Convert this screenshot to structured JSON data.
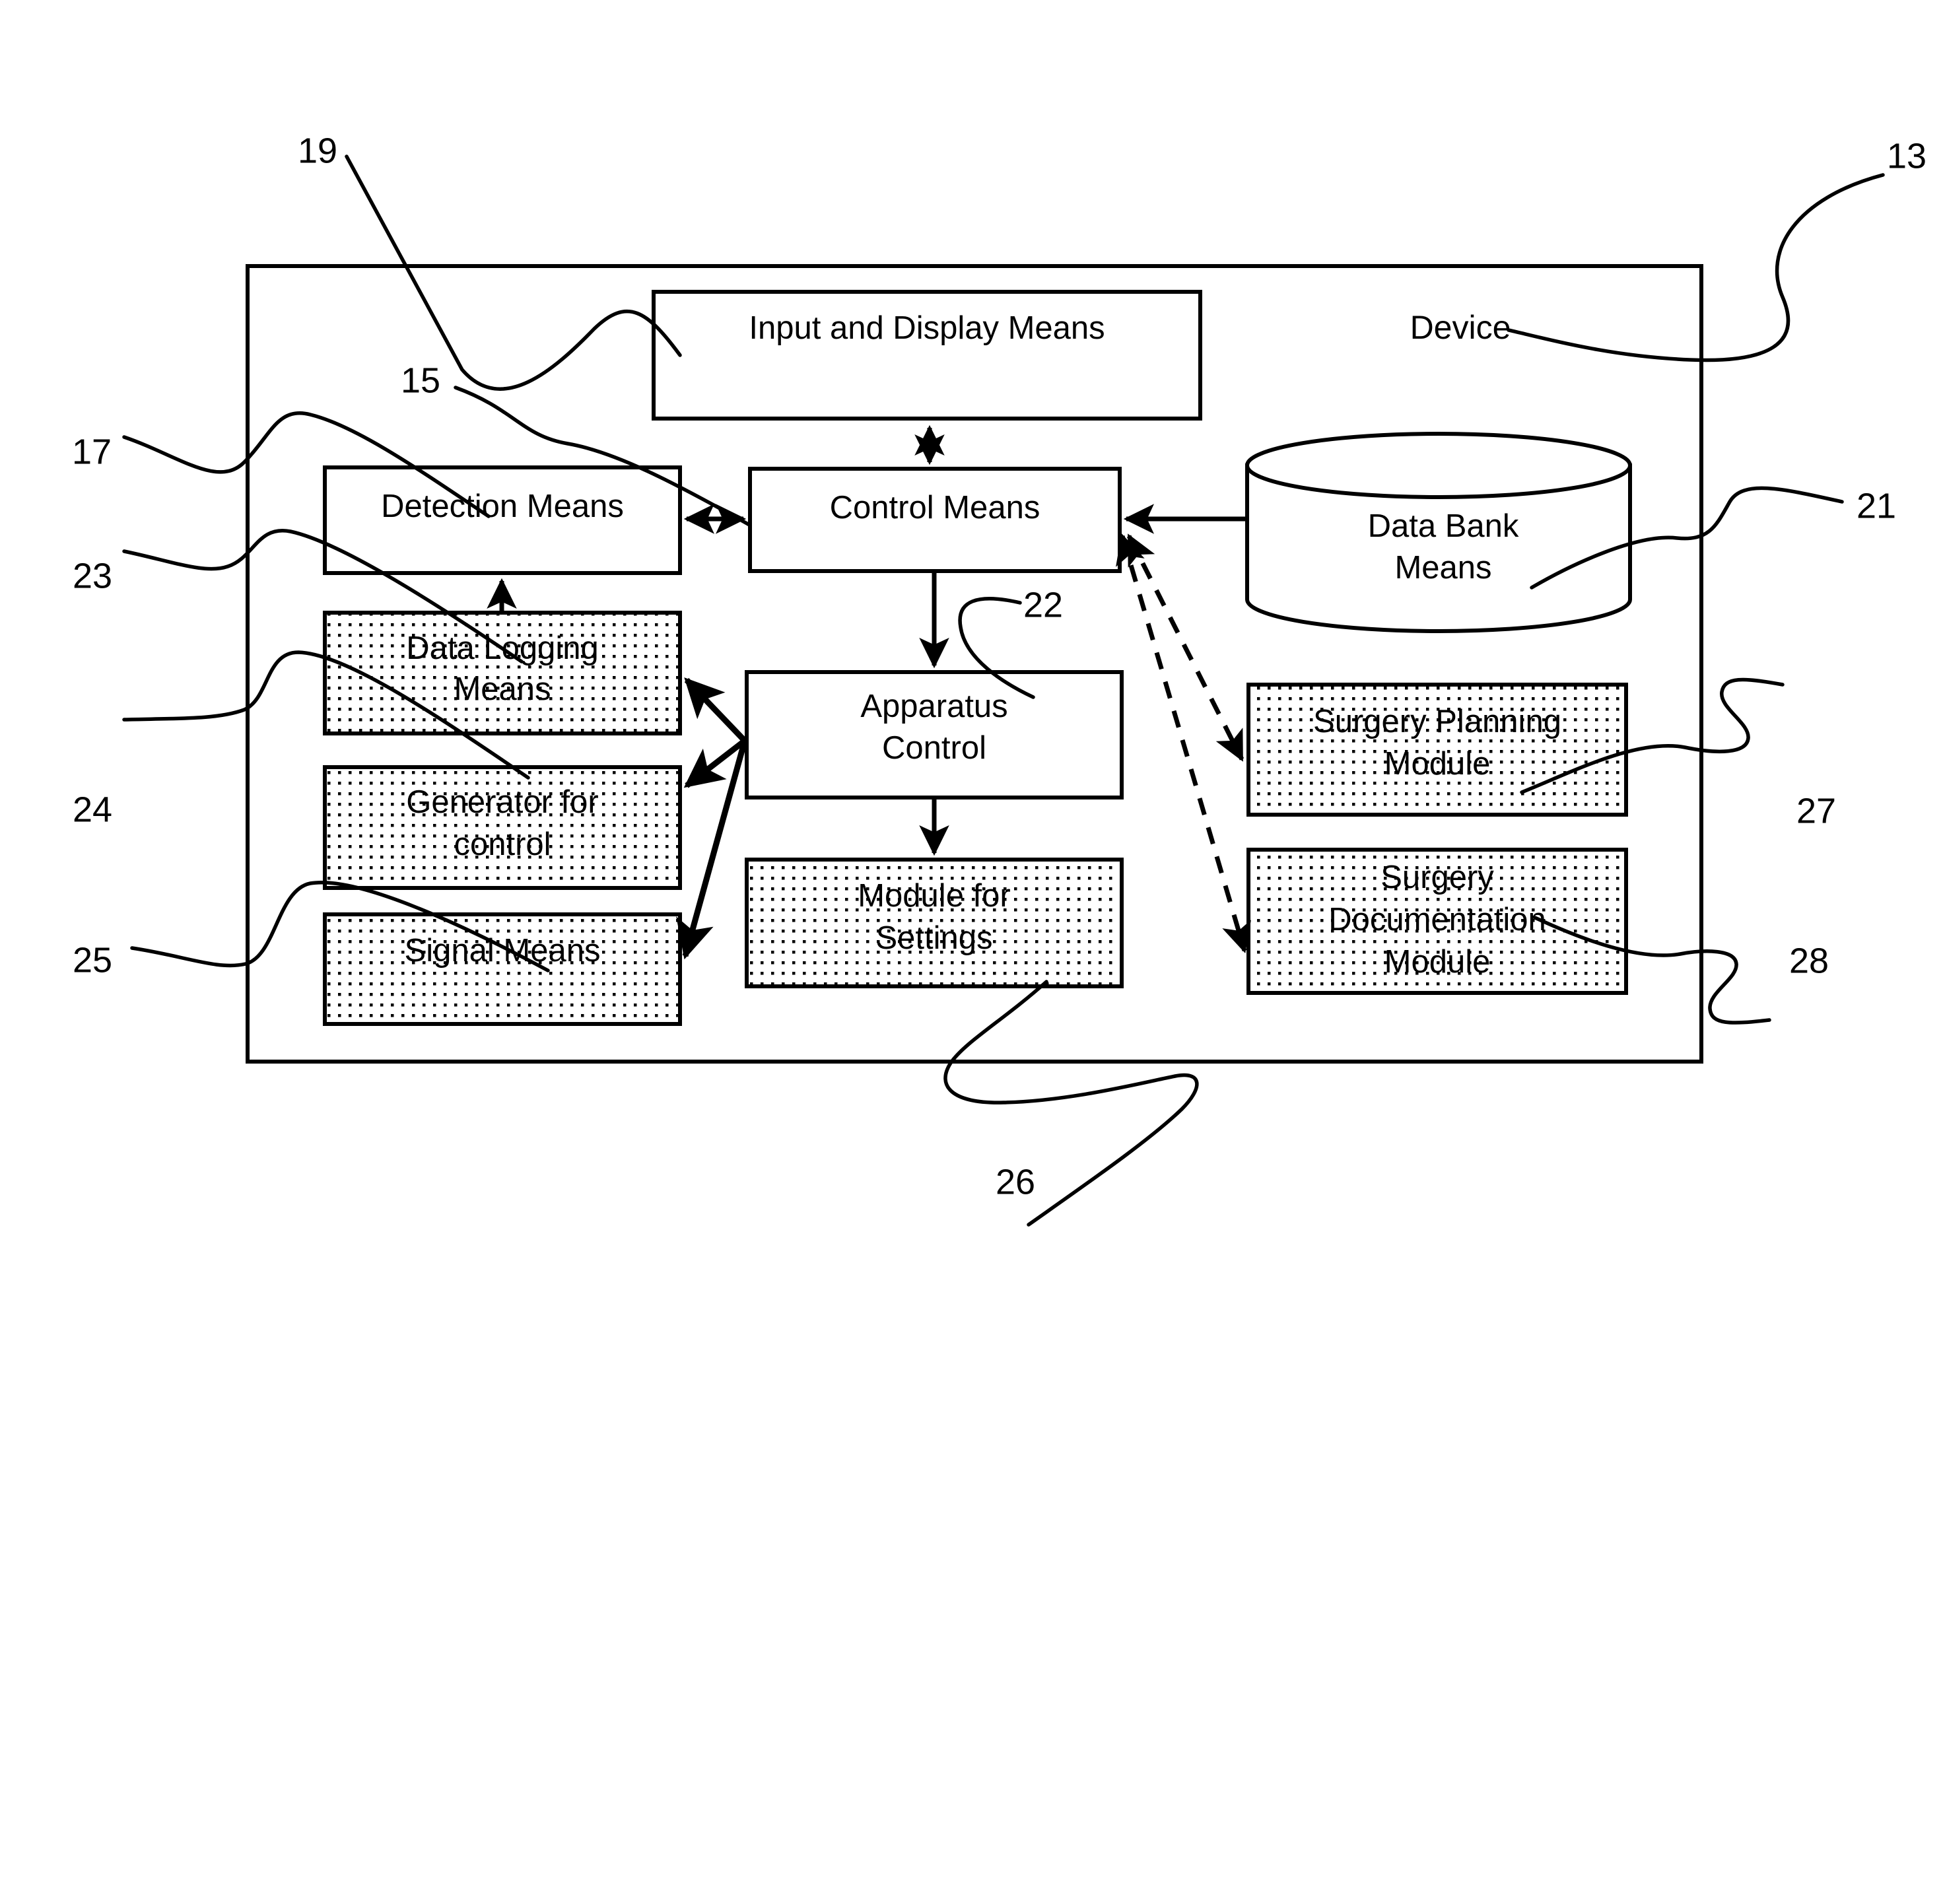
{
  "figure": {
    "kind": "patent-block-diagram",
    "outer_label": "Device",
    "outer_ref": "13"
  },
  "blocks": {
    "input_display": {
      "label": "Input and Display Means",
      "ref": "19",
      "shaded": false
    },
    "control_means": {
      "label": "Control Means",
      "ref": "15",
      "shaded": false
    },
    "detection_means": {
      "label": "Detection Means",
      "ref": "17",
      "shaded": false
    },
    "data_logging": {
      "label_line1": "Data Logging",
      "label_line2": "Means",
      "ref": "23",
      "shaded": true
    },
    "generator_control": {
      "label_line1": "Generator for",
      "label_line2": "control",
      "ref": "24",
      "shaded": true
    },
    "signal_means": {
      "label": "Signal Means",
      "ref": "25",
      "shaded": true
    },
    "apparatus_control": {
      "label_line1": "Apparatus",
      "label_line2": "Control",
      "ref": "22",
      "shaded": false
    },
    "module_settings": {
      "label_line1": "Module for",
      "label_line2": "Settings",
      "ref": "26",
      "shaded": true
    },
    "data_bank": {
      "label_line1": "Data Bank",
      "label_line2": "Means",
      "ref": "21",
      "shaded": false,
      "shape": "cylinder"
    },
    "surgery_planning": {
      "label_line1": "Surgery Planning",
      "label_line2": "Module",
      "ref": "27",
      "shaded": true
    },
    "surgery_documentation": {
      "label_line1": "Surgery",
      "label_line2": "Documentation",
      "label_line3": "Module",
      "ref": "28",
      "shaded": true
    }
  },
  "reference_numerals": [
    {
      "id": "19",
      "value": "19"
    },
    {
      "id": "13",
      "value": "13"
    },
    {
      "id": "15",
      "value": "15"
    },
    {
      "id": "17",
      "value": "17"
    },
    {
      "id": "21",
      "value": "21"
    },
    {
      "id": "23",
      "value": "23"
    },
    {
      "id": "24",
      "value": "24"
    },
    {
      "id": "25",
      "value": "25"
    },
    {
      "id": "22",
      "value": "22"
    },
    {
      "id": "27",
      "value": "27"
    },
    {
      "id": "28",
      "value": "28"
    },
    {
      "id": "26",
      "value": "26"
    }
  ],
  "connections": [
    {
      "from": "input_display",
      "to": "control_means",
      "style": "solid",
      "arrows": "both"
    },
    {
      "from": "detection_means",
      "to": "control_means",
      "style": "solid",
      "arrows": "both"
    },
    {
      "from": "data_logging",
      "to": "detection_means",
      "style": "solid",
      "arrows": "to"
    },
    {
      "from": "control_means",
      "to": "apparatus_control",
      "style": "solid",
      "arrows": "to"
    },
    {
      "from": "apparatus_control",
      "to": "module_settings",
      "style": "solid",
      "arrows": "to"
    },
    {
      "from": "apparatus_control",
      "to": "data_logging",
      "style": "solid",
      "arrows": "to"
    },
    {
      "from": "apparatus_control",
      "to": "generator_control",
      "style": "solid",
      "arrows": "to"
    },
    {
      "from": "apparatus_control",
      "to": "signal_means",
      "style": "solid",
      "arrows": "to"
    },
    {
      "from": "data_bank",
      "to": "control_means",
      "style": "solid",
      "arrows": "to"
    },
    {
      "from": "control_means",
      "to": "surgery_planning",
      "style": "dashed",
      "arrows": "both"
    },
    {
      "from": "control_means",
      "to": "surgery_documentation",
      "style": "dashed",
      "arrows": "both"
    }
  ],
  "colors": {
    "line": "#000000",
    "background": "#ffffff",
    "shaded_fill": "#ffffff",
    "stipple_dot": "#000000"
  }
}
